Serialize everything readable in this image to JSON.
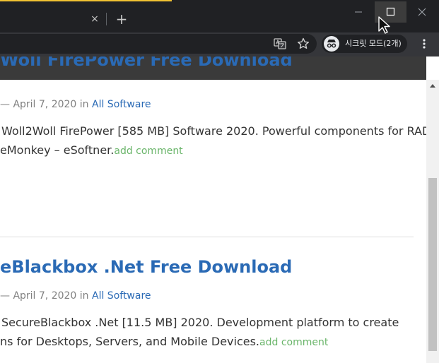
{
  "browser": {
    "tab": {
      "close_glyph": "×",
      "newtab_glyph": "+"
    },
    "incognito": {
      "label": "시크릿 모드(2개)"
    }
  },
  "page": {
    "post1": {
      "title_partial": "Woll FirePower Free Download",
      "meta_prefix": "— April 7, 2020 in ",
      "category": "All Software",
      "excerpt_line1": "Woll2Woll FirePower [585 MB] Software 2020. Powerful components for RAD",
      "excerpt_line2": "eMonkey – eSoftner.",
      "add_comment": "add comment"
    },
    "post2": {
      "title": "eBlackbox .Net Free Download",
      "meta_prefix": "— April 7, 2020 in ",
      "category": "All Software",
      "excerpt_line1": "SecureBlackbox .Net [11.5 MB] 2020. Development platform to create",
      "excerpt_line2": "ns for Desktops, Servers, and Mobile Devices.",
      "add_comment": "add comment"
    }
  },
  "colors": {
    "link": "#2a6ab5",
    "comment": "#6ab56a",
    "chrome_dark": "#202124",
    "toolbar": "#35363a",
    "tab_accent": "#f1c232"
  },
  "icons": [
    "close-icon",
    "plus-icon",
    "minimize-icon",
    "maximize-icon",
    "window-close-icon",
    "translate-icon",
    "star-icon",
    "incognito-icon",
    "kebab-menu-icon",
    "scroll-up-arrow-icon",
    "mouse-cursor-icon"
  ]
}
